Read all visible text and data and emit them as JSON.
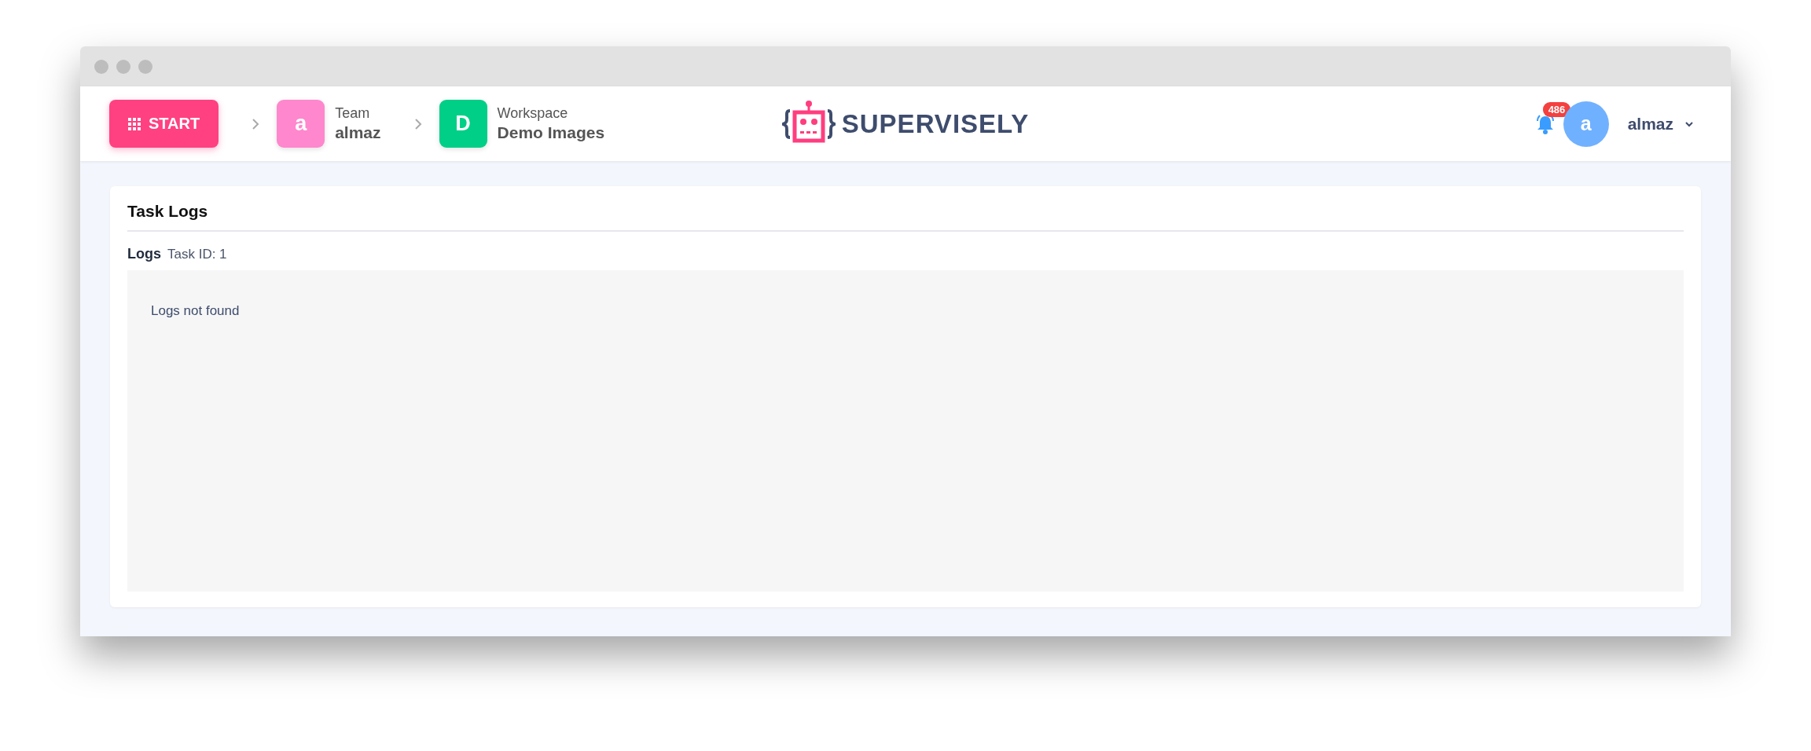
{
  "header": {
    "start_button": {
      "label": "START"
    },
    "breadcrumbs": [
      {
        "initial": "a",
        "color": "#ff87cd",
        "caption": "Team",
        "name": "almaz"
      },
      {
        "initial": "D",
        "color": "#00cf87",
        "caption": "Workspace",
        "name": "Demo Images"
      }
    ],
    "logo": {
      "text": "SUPERVISELY"
    },
    "notifications": {
      "count": "486"
    },
    "user": {
      "initial": "a",
      "name": "almaz"
    }
  },
  "card": {
    "title": "Task Logs",
    "section_label": "Logs",
    "task_id": "Task ID: 1",
    "message": "Logs not found"
  }
}
